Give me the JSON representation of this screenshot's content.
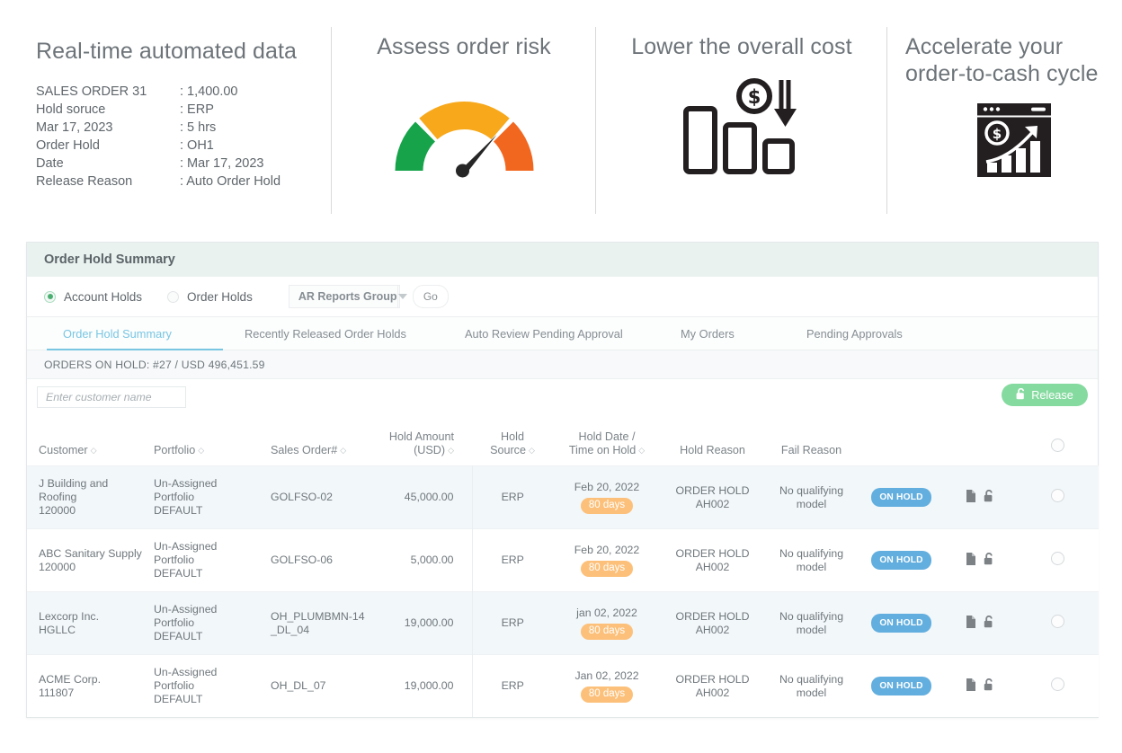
{
  "features": [
    {
      "title": "Real-time automated data",
      "rows": [
        {
          "label": "SALES ORDER 31",
          "value": ": 1,400.00"
        },
        {
          "label": "Hold soruce",
          "value": ": ERP"
        },
        {
          "label": "Mar 17, 2023",
          "value": ": 5 hrs"
        },
        {
          "label": "Order Hold",
          "value": ": OH1"
        },
        {
          "label": "Date",
          "value": ": Mar 17, 2023"
        },
        {
          "label": "Release Reason",
          "value": ": Auto Order Hold"
        }
      ]
    },
    {
      "title": "Assess order risk",
      "icon": "risk-gauge-icon"
    },
    {
      "title": "Lower the overall cost",
      "icon": "declining-bars-dollar-icon"
    },
    {
      "title": "Accelerate your\norder-to-cash cycle",
      "icon": "growth-dashboard-icon"
    }
  ],
  "panel": {
    "header_title": "Order Hold Summary",
    "radios": [
      {
        "label": "Account Holds",
        "selected": true
      },
      {
        "label": "Order Holds",
        "selected": false
      }
    ],
    "report_select": "AR Reports Group",
    "go_label": "Go",
    "tabs": [
      {
        "label": "Order Hold Summary",
        "active": true
      },
      {
        "label": "Recently Released Order Holds",
        "active": false
      },
      {
        "label": "Auto Review Pending Approval",
        "active": false
      },
      {
        "label": "My Orders",
        "active": false
      },
      {
        "label": "Pending Approvals",
        "active": false
      }
    ],
    "summary_text": "ORDERS ON HOLD: #27 / USD 496,451.59",
    "search_placeholder": "Enter customer name",
    "release_label": "Release",
    "columns": [
      {
        "label": "Customer",
        "sortable": true
      },
      {
        "label": "Portfolio",
        "sortable": true
      },
      {
        "label": "Sales Order#",
        "sortable": true
      },
      {
        "label": "Hold Amount\n(USD)",
        "sortable": true
      },
      {
        "label": "Hold\nSource",
        "sortable": true
      },
      {
        "label": "Hold Date /\nTime on Hold",
        "sortable": true
      },
      {
        "label": "Hold Reason",
        "sortable": false
      },
      {
        "label": "Fail Reason",
        "sortable": false
      }
    ],
    "rows": [
      {
        "customer_name": "J Building and Roofing",
        "customer_id": "120000",
        "portfolio_line1": "Un-Assigned Portfolio",
        "portfolio_line2": "DEFAULT",
        "sales_order": "GOLFSO-02",
        "amount": "45,000.00",
        "source": "ERP",
        "hold_date": "Feb 20, 2022",
        "time_on_hold": "80 days",
        "hold_reason_line1": "ORDER HOLD",
        "hold_reason_line2": "AH002",
        "fail_reason_line1": "No qualifying",
        "fail_reason_line2": "model",
        "status": "ON HOLD"
      },
      {
        "customer_name": "ABC Sanitary Supply",
        "customer_id": "120000",
        "portfolio_line1": "Un-Assigned Portfolio",
        "portfolio_line2": "DEFAULT",
        "sales_order": "GOLFSO-06",
        "amount": "5,000.00",
        "source": "ERP",
        "hold_date": "Feb 20, 2022",
        "time_on_hold": "80 days",
        "hold_reason_line1": "ORDER HOLD",
        "hold_reason_line2": "AH002",
        "fail_reason_line1": "No qualifying",
        "fail_reason_line2": "model",
        "status": "ON HOLD"
      },
      {
        "customer_name": "Lexcorp Inc.",
        "customer_id": "HGLLC",
        "portfolio_line1": "Un-Assigned Portfolio",
        "portfolio_line2": "DEFAULT",
        "sales_order": "OH_PLUMBMN-14_DL_04",
        "amount": "19,000.00",
        "source": "ERP",
        "hold_date": "jan 02, 2022",
        "time_on_hold": "80 days",
        "hold_reason_line1": "ORDER HOLD",
        "hold_reason_line2": "AH002",
        "fail_reason_line1": "No qualifying",
        "fail_reason_line2": "model",
        "status": "ON HOLD"
      },
      {
        "customer_name": "ACME Corp.",
        "customer_id": "111807",
        "portfolio_line1": "Un-Assigned Portfolio",
        "portfolio_line2": "DEFAULT",
        "sales_order": "OH_DL_07",
        "amount": "19,000.00",
        "source": "ERP",
        "hold_date": "Jan 02, 2022",
        "time_on_hold": "80 days",
        "hold_reason_line1": "ORDER HOLD",
        "hold_reason_line2": "AH002",
        "fail_reason_line1": "No qualifying",
        "fail_reason_line2": "model",
        "status": "ON HOLD"
      }
    ]
  },
  "colors": {
    "panel_header_bg": "#e9f2ef",
    "active_tab": "#79c6e3",
    "release_green": "#85da9f",
    "badge_blue": "#62aede",
    "days_orange": "#fcc07a",
    "gauge_green": "#16a34a",
    "gauge_amber": "#f7a81b",
    "gauge_orange": "#f2671f"
  }
}
